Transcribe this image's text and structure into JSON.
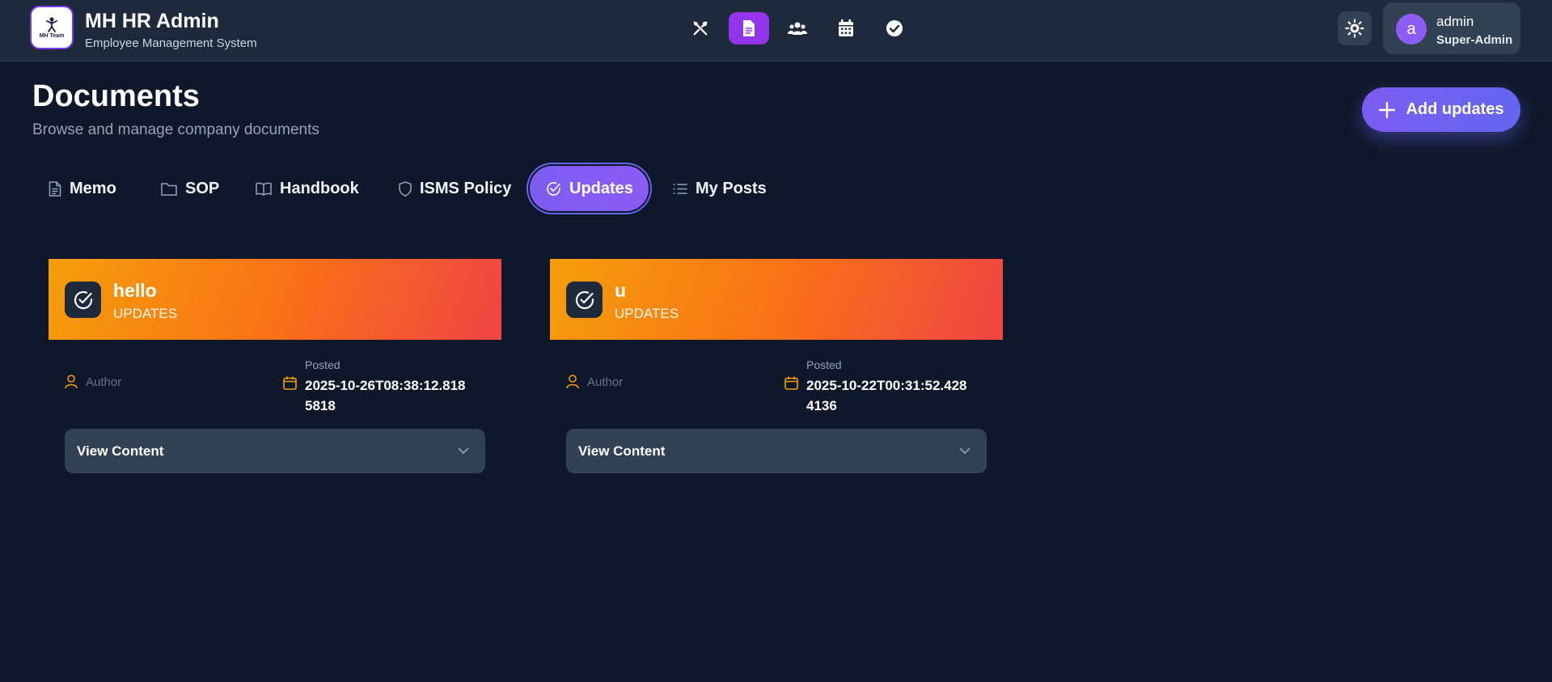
{
  "header": {
    "logo_text": "MH Team",
    "title": "MH HR Admin",
    "subtitle": "Employee Management System",
    "nav": [
      {
        "icon": "tools-icon",
        "active": false
      },
      {
        "icon": "document-icon",
        "active": true
      },
      {
        "icon": "users-icon",
        "active": false
      },
      {
        "icon": "calendar-icon",
        "active": false
      },
      {
        "icon": "check-circle-icon",
        "active": false
      }
    ],
    "theme_icon": "sun-icon",
    "user": {
      "avatar_letter": "a",
      "name": "admin",
      "role": "Super-Admin"
    }
  },
  "page": {
    "title": "Documents",
    "subtitle": "Browse and manage company documents",
    "add_button_label": "Add updates"
  },
  "tabs": [
    {
      "label": "Memo",
      "icon": "file-icon",
      "active": false
    },
    {
      "label": "SOP",
      "icon": "folder-icon",
      "active": false
    },
    {
      "label": "Handbook",
      "icon": "book-icon",
      "active": false
    },
    {
      "label": "ISMS Policy",
      "icon": "shield-icon",
      "active": false
    },
    {
      "label": "Updates",
      "icon": "check-circle-icon",
      "active": true
    },
    {
      "label": "My Posts",
      "icon": "list-icon",
      "active": false
    }
  ],
  "cards": [
    {
      "title": "hello",
      "type": "UPDATES",
      "author_label": "Author",
      "posted_label": "Posted",
      "posted_value": "2025-10-26T08:38:12.8185818",
      "view_label": "View Content"
    },
    {
      "title": "u",
      "type": "UPDATES",
      "author_label": "Author",
      "posted_label": "Posted",
      "posted_value": "2025-10-22T00:31:52.4284136",
      "view_label": "View Content"
    }
  ],
  "colors": {
    "background": "#0f172a",
    "header": "#1e293b",
    "accent": "#7c5cf0",
    "active_nav": "#9333ea",
    "card_gradient_start": "#f59e0b",
    "card_gradient_end": "#ef4444",
    "meta_icon": "#f59e0b"
  }
}
